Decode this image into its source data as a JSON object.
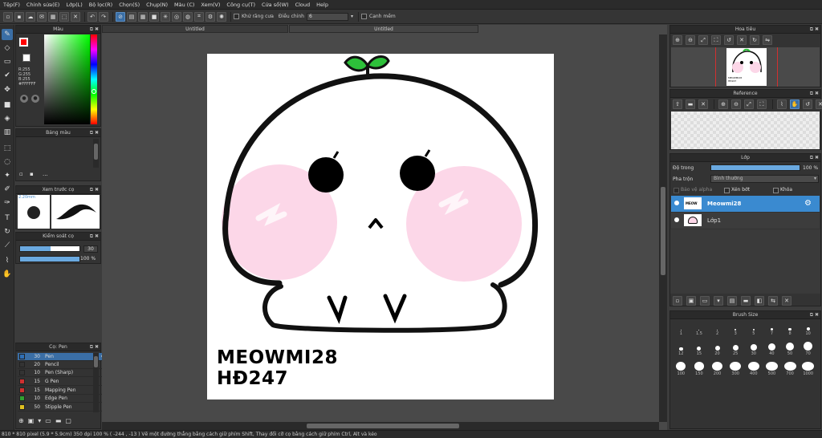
{
  "menu": [
    "Tệp(F)",
    "Chỉnh sửa(E)",
    "Lớp(L)",
    "Bộ lọc(R)",
    "Chọn(S)",
    "Chụp(N)",
    "Màu (C)",
    "Xem(V)",
    "Công cụ(T)",
    "Cửa sổ(W)",
    "Cloud",
    "Help"
  ],
  "toolbar": {
    "antialias_label": "Khử răng cưa",
    "adjust_label": "Điều chỉnh",
    "adjust_value": "6",
    "edge_label": "Cạnh mềm"
  },
  "color_panel": {
    "title": "Màu",
    "r": "R:255",
    "g": "G:255",
    "b": "B:255",
    "hex": "#FFFFFF",
    "primary_color": "#ff0000",
    "secondary_color": "#ffffff"
  },
  "palette_panel": {
    "title": "Bảng màu",
    "dots": "..."
  },
  "brush_preview": {
    "title": "Xem trước cọ",
    "size": "2.20mm"
  },
  "brush_control": {
    "title": "Kiểm soát cọ",
    "size_value": "30",
    "opacity_value": "100 %"
  },
  "pen_panel": {
    "title": "Cọ: Pen",
    "items": [
      {
        "size": "30",
        "name": "Pen",
        "color": "#2f6fb5"
      },
      {
        "size": "20",
        "name": "Pencil",
        "color": "#333333"
      },
      {
        "size": "10",
        "name": "Pen (Sharp)",
        "color": "#333333"
      },
      {
        "size": "15",
        "name": "G Pen",
        "color": "#d03030"
      },
      {
        "size": "15",
        "name": "Mapping Pen",
        "color": "#d03030"
      },
      {
        "size": "10",
        "name": "Edge Pen",
        "color": "#30a030"
      },
      {
        "size": "50",
        "name": "Stipple Pen",
        "color": "#e0c020"
      }
    ]
  },
  "canvas": {
    "tab1": "Untitled",
    "tab2": "Untitled",
    "text_line1": "MEOWMI28",
    "text_line2": "HĐ247"
  },
  "navigator": {
    "title": "Hoa tiêu",
    "thumb_text": "MEOWMI28 HĐ247"
  },
  "reference": {
    "title": "Reference"
  },
  "layers": {
    "title": "Lớp",
    "opacity_label": "Độ trong",
    "opacity_value": "100 %",
    "blend_label": "Pha trộn",
    "blend_value": "Bình thường",
    "protect_alpha": "Bảo vệ alpha",
    "clipping": "Xén bớt",
    "lock": "Khóa",
    "items": [
      {
        "name": "Meowmi28"
      },
      {
        "name": "Lớp1"
      }
    ]
  },
  "brush_size": {
    "title": "Brush Size",
    "sizes": [
      "1",
      "1.5",
      "2",
      "3",
      "5",
      "7",
      "8",
      "10",
      "12",
      "15",
      "20",
      "25",
      "30",
      "40",
      "50",
      "70",
      "100",
      "150",
      "200",
      "300",
      "400",
      "500",
      "700",
      "1000"
    ]
  },
  "status": "810 * 810 pixel   (5.9 * 5.9cm)   350 dpi   100 %   ( -244 , -13 )   Vẽ một đường thẳng bằng cách giữ phím Shift, Thay đổi cỡ cọ bằng cách giữ phím Ctrl, Alt và kéo"
}
